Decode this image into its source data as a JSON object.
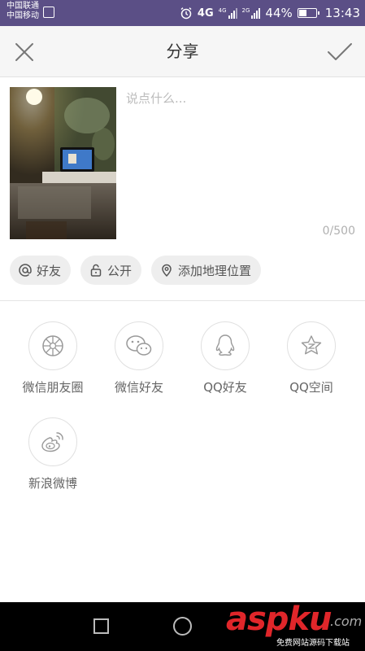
{
  "status_bar": {
    "carrier_1": "中国联通",
    "carrier_2": "中国移动",
    "net_1": "4G",
    "net_2": "4G",
    "net_3": "2G",
    "battery": "44%",
    "time": "13:43"
  },
  "header": {
    "title": "分享"
  },
  "composer": {
    "placeholder": "说点什么...",
    "counter": "0/500"
  },
  "chips": [
    {
      "label": "好友",
      "icon": "at-icon"
    },
    {
      "label": "公开",
      "icon": "lock-icon"
    },
    {
      "label": "添加地理位置",
      "icon": "location-pin-icon"
    }
  ],
  "share_targets": [
    {
      "label": "微信朋友圈",
      "icon": "wechat-moments-icon"
    },
    {
      "label": "微信好友",
      "icon": "wechat-icon"
    },
    {
      "label": "QQ好友",
      "icon": "qq-icon"
    },
    {
      "label": "QQ空间",
      "icon": "qzone-icon"
    },
    {
      "label": "新浪微博",
      "icon": "weibo-icon"
    }
  ],
  "watermark": {
    "main": "aspku",
    "com": ".com",
    "sub": "免费网站源码下载站"
  },
  "colors": {
    "status_bar": "#5b4f86",
    "title_bar": "#f6f6f6",
    "chip_bg": "#eeeeee",
    "watermark_red": "#e0262a"
  }
}
